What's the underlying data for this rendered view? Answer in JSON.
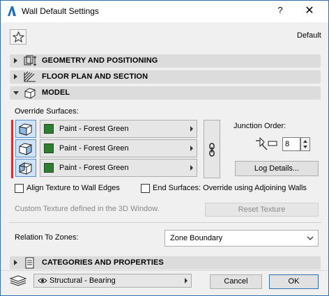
{
  "window": {
    "title": "Wall Default Settings",
    "help_glyph": "?",
    "close_glyph": "✕"
  },
  "header": {
    "favorites_icon": "star-icon",
    "default_label": "Default"
  },
  "sections": {
    "geometry": {
      "label": "GEOMETRY AND POSITIONING",
      "expanded": false,
      "icon": "geometry-icon"
    },
    "floorplan": {
      "label": "FLOOR PLAN AND SECTION",
      "expanded": false,
      "icon": "floor-plan-icon"
    },
    "model": {
      "label": "MODEL",
      "expanded": true,
      "icon": "model-icon"
    },
    "categories": {
      "label": "CATEGORIES AND PROPERTIES",
      "expanded": false,
      "icon": "list-icon"
    }
  },
  "model": {
    "override_label": "Override Surfaces:",
    "surfaces": [
      {
        "name": "Paint - Forest Green",
        "color": "#2f7d32",
        "icon": "wall-face-outside-icon"
      },
      {
        "name": "Paint - Forest Green",
        "color": "#2f7d32",
        "icon": "wall-edge-icon"
      },
      {
        "name": "Paint - Forest Green",
        "color": "#2f7d32",
        "icon": "wall-face-inside-icon"
      }
    ],
    "junction_label": "Junction Order:",
    "junction_value": "8",
    "log_details": "Log Details...",
    "align_texture_label": "Align Texture to Wall Edges",
    "end_surfaces_label": "End Surfaces: Override using Adjoining Walls",
    "custom_texture_hint": "Custom Texture defined in the 3D Window.",
    "reset_texture": "Reset Texture",
    "relation_label": "Relation To Zones:",
    "relation_value": "Zone Boundary"
  },
  "footer": {
    "layer_value": "Structural - Bearing",
    "cancel": "Cancel",
    "ok": "OK"
  },
  "colors": {
    "accent_border": "#2f6fb0",
    "override_bar": "#d83030",
    "icon_fill": "#cfe3f7"
  }
}
